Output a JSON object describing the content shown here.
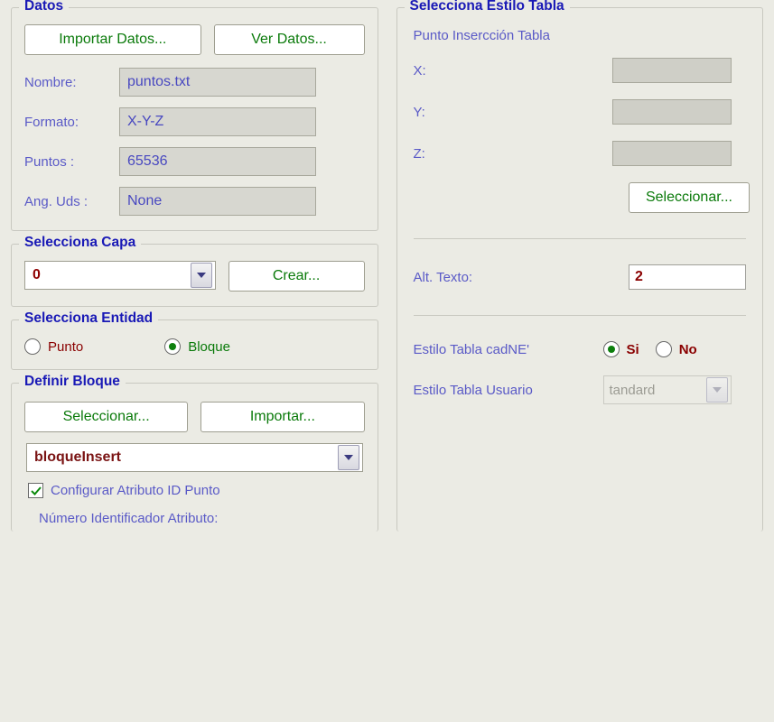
{
  "datos": {
    "title": "Datos",
    "import_btn": "Importar Datos...",
    "view_btn": "Ver Datos...",
    "nombre_label": "Nombre:",
    "nombre_value": "puntos.txt",
    "formato_label": "Formato:",
    "formato_value": "X-Y-Z",
    "puntos_label": "Puntos :",
    "puntos_value": "65536",
    "ang_label": "Ang. Uds :",
    "ang_value": "None"
  },
  "capa": {
    "title": "Selecciona Capa",
    "value": "0",
    "crear_btn": "Crear..."
  },
  "entidad": {
    "title": "Selecciona Entidad",
    "punto": "Punto",
    "bloque": "Bloque",
    "selected": "bloque"
  },
  "bloque": {
    "title": "Definir Bloque",
    "seleccionar_btn": "Seleccionar...",
    "importar_btn": "Importar...",
    "combo_value": "bloqueInsert",
    "check_label": "Configurar Atributo ID Punto",
    "check_checked": true,
    "num_label": "Número Identificador Atributo:"
  },
  "tabla": {
    "title": "Selecciona Estilo Tabla",
    "punto_ins_label": "Punto Insercción Tabla",
    "x_label": "X:",
    "y_label": "Y:",
    "z_label": "Z:",
    "x_value": "",
    "y_value": "",
    "z_value": "",
    "seleccionar_btn": "Seleccionar...",
    "alt_label": "Alt. Texto:",
    "alt_value": "2",
    "estilo_cadne_label": "Estilo Tabla  cadNE'",
    "si": "Si",
    "no": "No",
    "estilo_cadne_selected": "si",
    "estilo_usuario_label": "Estilo Tabla  Usuario",
    "estilo_usuario_value": "tandard"
  }
}
